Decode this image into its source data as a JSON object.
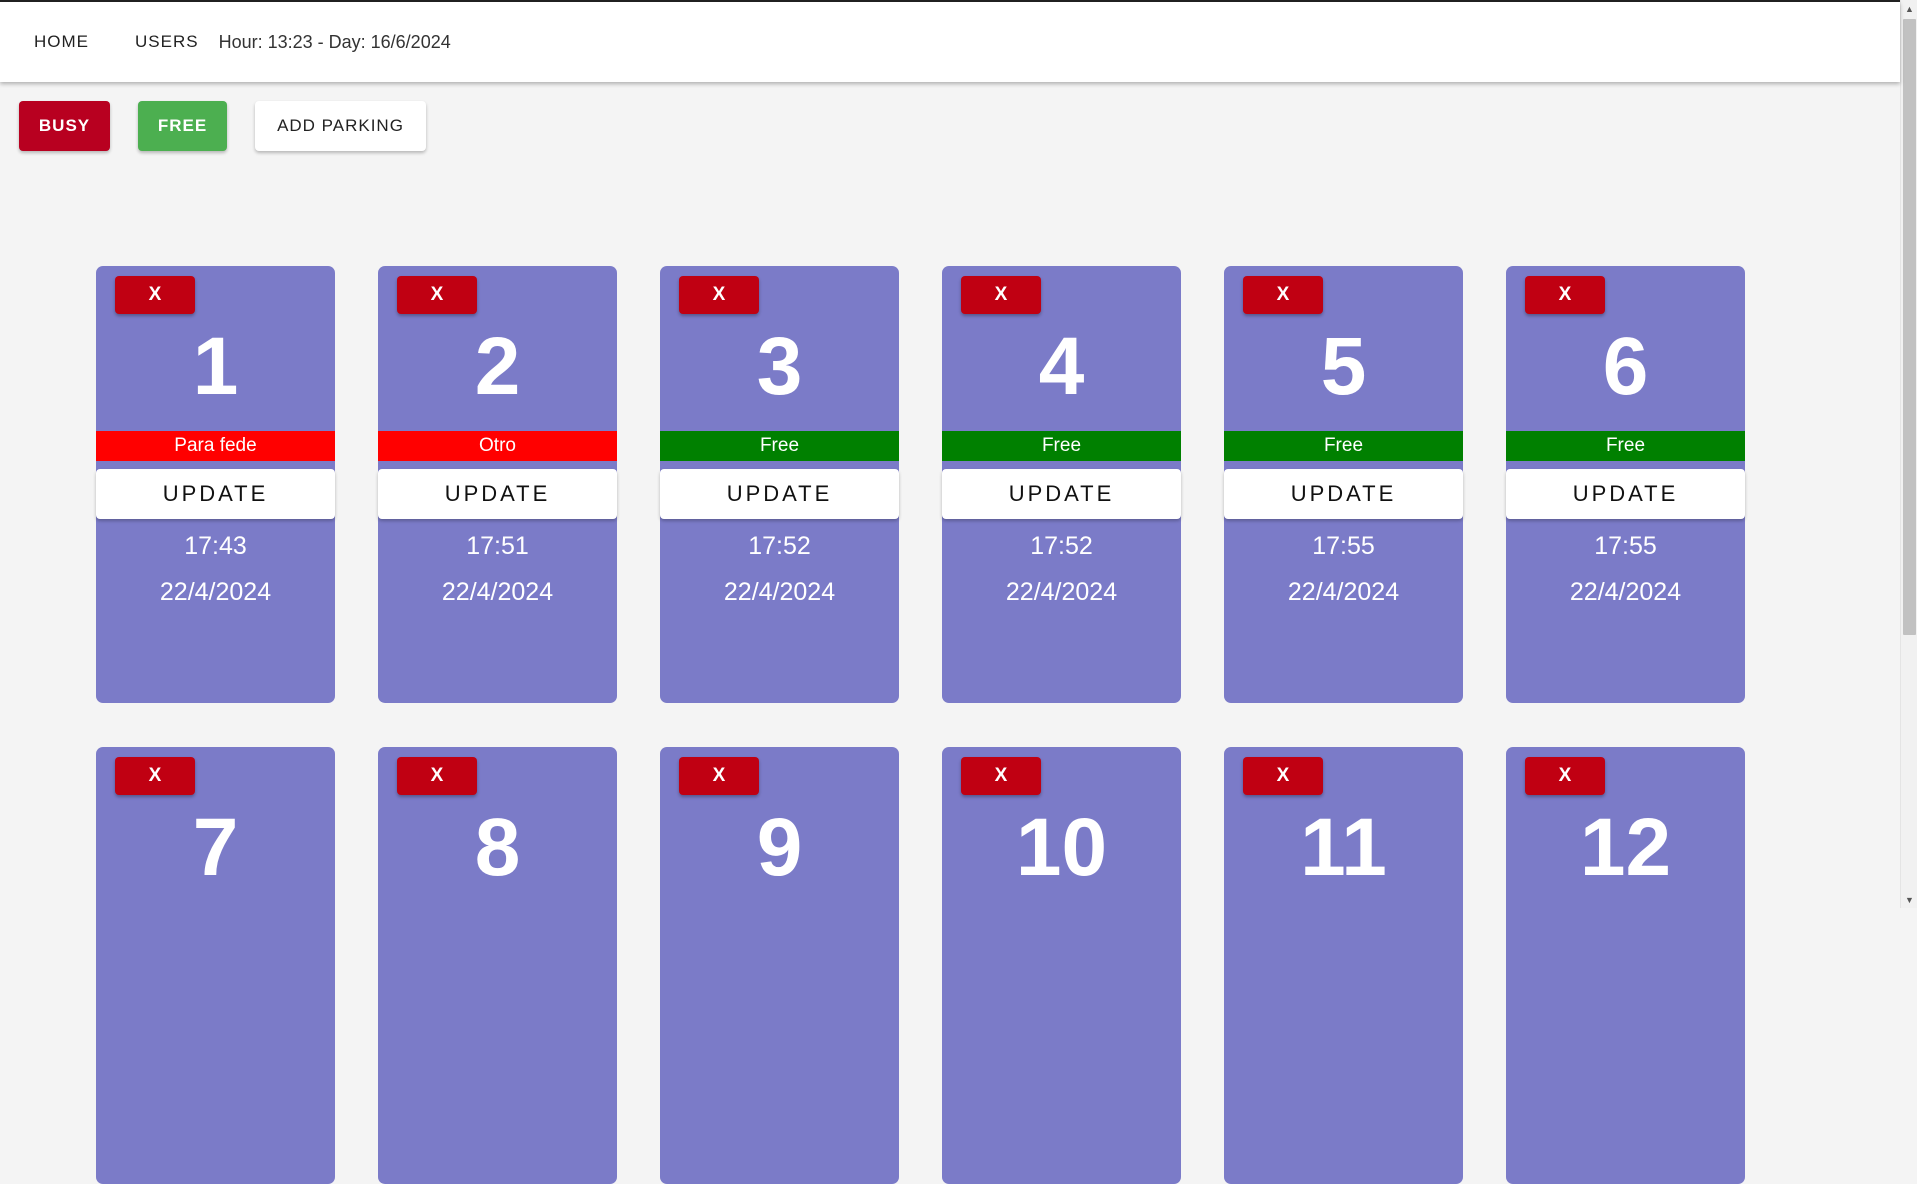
{
  "header": {
    "nav": [
      "HOME",
      "USERS"
    ],
    "clock": "Hour: 13:23 - Day: 16/6/2024"
  },
  "toolbar": {
    "busy_label": "BUSY",
    "free_label": "FREE",
    "add_label": "ADD PARKING"
  },
  "colors": {
    "card_bg": "#7b7bc8",
    "busy_status": "#ff0000",
    "free_status": "#008000",
    "delete_button": "#c00012",
    "busy_button": "#b80020",
    "free_button": "#4caf50"
  },
  "cards": [
    {
      "delete_label": "X",
      "number": "1",
      "status": "Para fede",
      "state": "busy",
      "update_label": "UPDATE",
      "time": "17:43",
      "date": "22/4/2024"
    },
    {
      "delete_label": "X",
      "number": "2",
      "status": "Otro",
      "state": "busy",
      "update_label": "UPDATE",
      "time": "17:51",
      "date": "22/4/2024"
    },
    {
      "delete_label": "X",
      "number": "3",
      "status": "Free",
      "state": "free",
      "update_label": "UPDATE",
      "time": "17:52",
      "date": "22/4/2024"
    },
    {
      "delete_label": "X",
      "number": "4",
      "status": "Free",
      "state": "free",
      "update_label": "UPDATE",
      "time": "17:52",
      "date": "22/4/2024"
    },
    {
      "delete_label": "X",
      "number": "5",
      "status": "Free",
      "state": "free",
      "update_label": "UPDATE",
      "time": "17:55",
      "date": "22/4/2024"
    },
    {
      "delete_label": "X",
      "number": "6",
      "status": "Free",
      "state": "free",
      "update_label": "UPDATE",
      "time": "17:55",
      "date": "22/4/2024"
    },
    {
      "delete_label": "X",
      "number": "7"
    },
    {
      "delete_label": "X",
      "number": "8"
    },
    {
      "delete_label": "X",
      "number": "9"
    },
    {
      "delete_label": "X",
      "number": "10"
    },
    {
      "delete_label": "X",
      "number": "11"
    },
    {
      "delete_label": "X",
      "number": "12"
    }
  ]
}
